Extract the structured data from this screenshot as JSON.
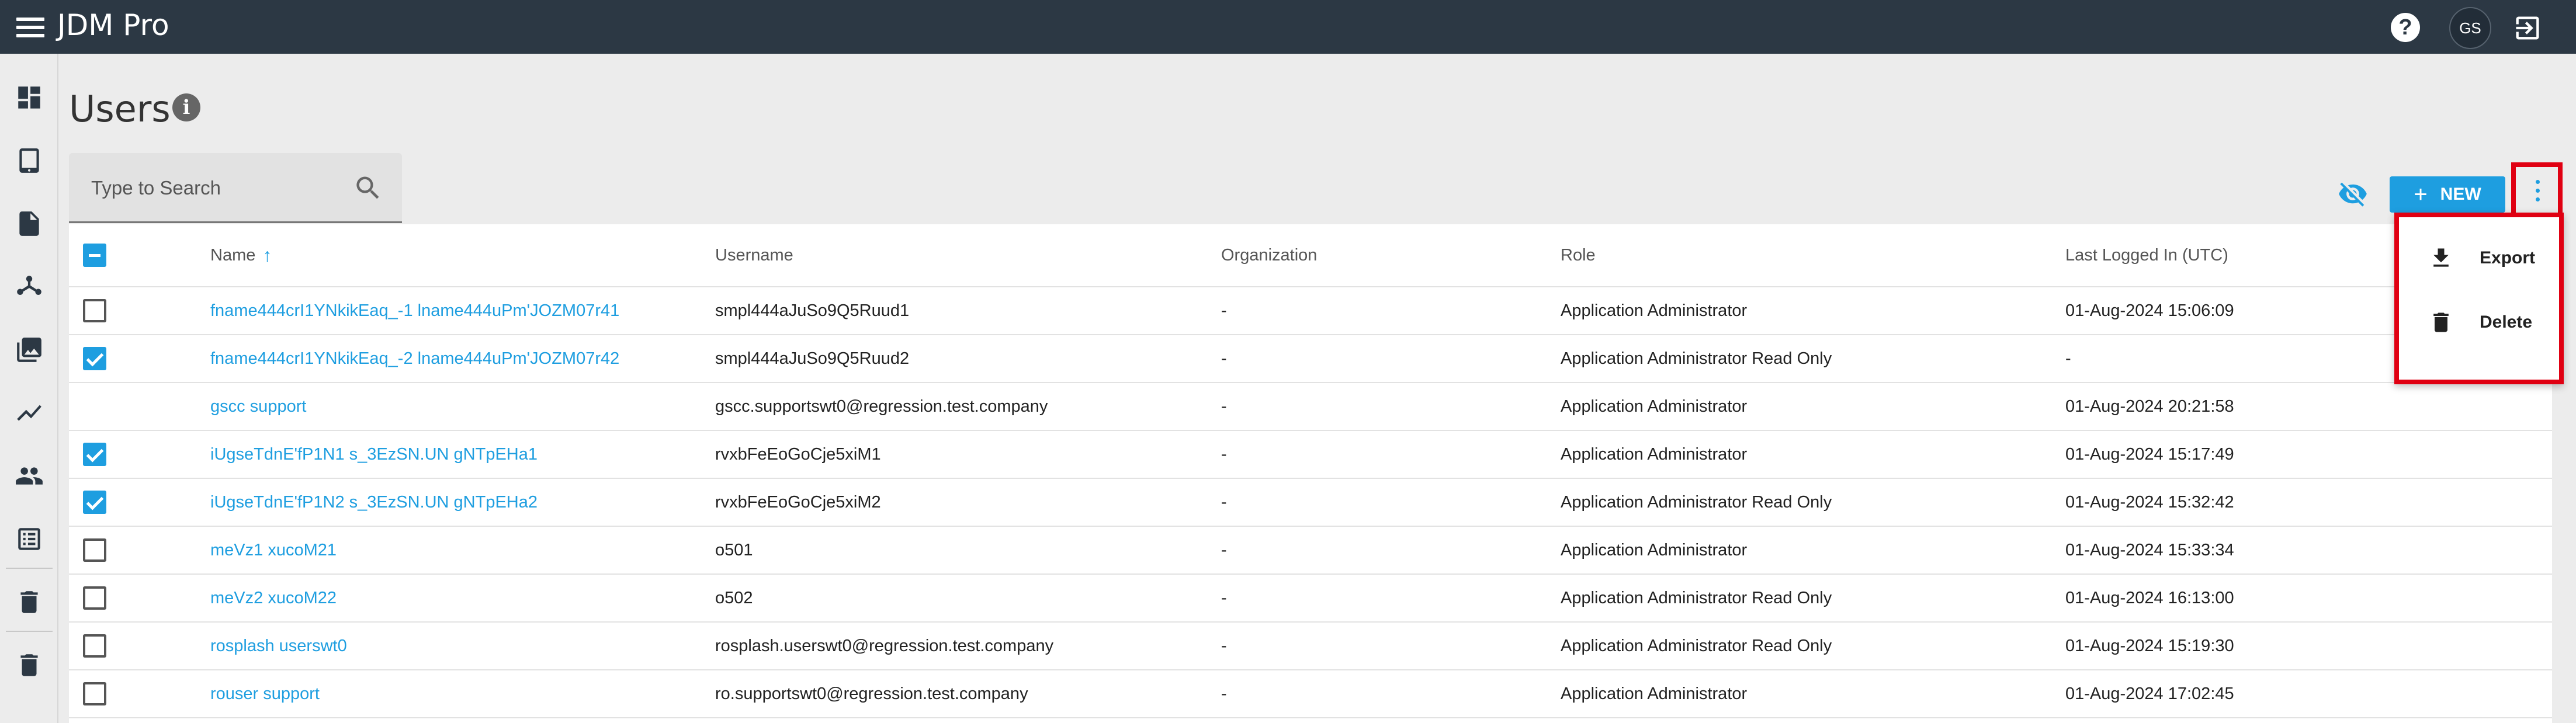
{
  "app": {
    "title": "JDM Pro"
  },
  "header": {
    "avatar_initials": "GS",
    "help_icon": "help-circle-icon",
    "logout_icon": "logout-icon"
  },
  "sidebar": {
    "items": [
      {
        "icon": "dashboard-icon"
      },
      {
        "icon": "tablet-icon"
      },
      {
        "icon": "document-icon"
      },
      {
        "icon": "hierarchy-icon"
      },
      {
        "icon": "media-library-icon"
      },
      {
        "icon": "trend-chart-icon"
      },
      {
        "icon": "users-icon"
      },
      {
        "icon": "list-icon"
      },
      {
        "icon": "trash-icon"
      },
      {
        "icon": "trash-icon"
      }
    ]
  },
  "page": {
    "title": "Users"
  },
  "search": {
    "placeholder": "Type to Search",
    "value": ""
  },
  "toolbar": {
    "new_label": "NEW",
    "new_icon": "+"
  },
  "menu": {
    "export_label": "Export",
    "delete_label": "Delete"
  },
  "table": {
    "columns": {
      "name": "Name",
      "sort_indicator": "↑",
      "username": "Username",
      "organization": "Organization",
      "role": "Role",
      "last_logged_in": "Last Logged In (UTC)"
    },
    "header_checkbox": "indeterminate",
    "rows": [
      {
        "name": "fname444crI1YNkikEaq_-1 lname444uPm'JOZM07r41",
        "username": "smpl444aJuSo9Q5Ruud1",
        "organization": "-",
        "role": "Application Administrator",
        "last_logged_in": "01-Aug-2024 15:06:09",
        "checkbox": "unchecked"
      },
      {
        "name": "fname444crI1YNkikEaq_-2 lname444uPm'JOZM07r42",
        "username": "smpl444aJuSo9Q5Ruud2",
        "organization": "-",
        "role": "Application Administrator Read Only",
        "last_logged_in": "-",
        "checkbox": "checked"
      },
      {
        "name": "gscc support",
        "username": "gscc.supportswt0@regression.test.company",
        "organization": "-",
        "role": "Application Administrator",
        "last_logged_in": "01-Aug-2024 20:21:58",
        "checkbox": "none"
      },
      {
        "name": "iUgseTdnE'fP1N1 s_3EzSN.UN gNTpEHa1",
        "username": "rvxbFeEoGoCje5xiM1",
        "organization": "-",
        "role": "Application Administrator",
        "last_logged_in": "01-Aug-2024 15:17:49",
        "checkbox": "checked"
      },
      {
        "name": "iUgseTdnE'fP1N2 s_3EzSN.UN gNTpEHa2",
        "username": "rvxbFeEoGoCje5xiM2",
        "organization": "-",
        "role": "Application Administrator Read Only",
        "last_logged_in": "01-Aug-2024 15:32:42",
        "checkbox": "checked"
      },
      {
        "name": "meVz1 xucoM21",
        "username": "o501",
        "organization": "-",
        "role": "Application Administrator",
        "last_logged_in": "01-Aug-2024 15:33:34",
        "checkbox": "unchecked"
      },
      {
        "name": "meVz2 xucoM22",
        "username": "o502",
        "organization": "-",
        "role": "Application Administrator Read Only",
        "last_logged_in": "01-Aug-2024 16:13:00",
        "checkbox": "unchecked"
      },
      {
        "name": "rosplash userswt0",
        "username": "rosplash.userswt0@regression.test.company",
        "organization": "-",
        "role": "Application Administrator Read Only",
        "last_logged_in": "01-Aug-2024 15:19:30",
        "checkbox": "unchecked"
      },
      {
        "name": "rouser support",
        "username": "ro.supportswt0@regression.test.company",
        "organization": "-",
        "role": "Application Administrator",
        "last_logged_in": "01-Aug-2024 17:02:45",
        "checkbox": "unchecked"
      }
    ]
  },
  "colors": {
    "topbar": "#2c3844",
    "accent": "#1e9ee0",
    "highlight": "#e00012"
  }
}
